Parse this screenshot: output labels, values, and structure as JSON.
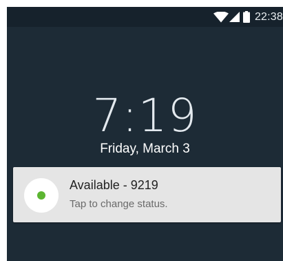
{
  "status_bar": {
    "time": "22:38",
    "icons": [
      "wifi-icon",
      "cellular-signal-icon",
      "battery-icon"
    ],
    "icon_color": "#ffffff"
  },
  "lock_screen": {
    "time": "7:19",
    "date": "Friday, March 3",
    "background_color": "#1d2b36"
  },
  "notification": {
    "title": "Available - 9219",
    "subtitle": "Tap to change status.",
    "status_color": "#5cb531",
    "icon": "status-dot-icon"
  }
}
